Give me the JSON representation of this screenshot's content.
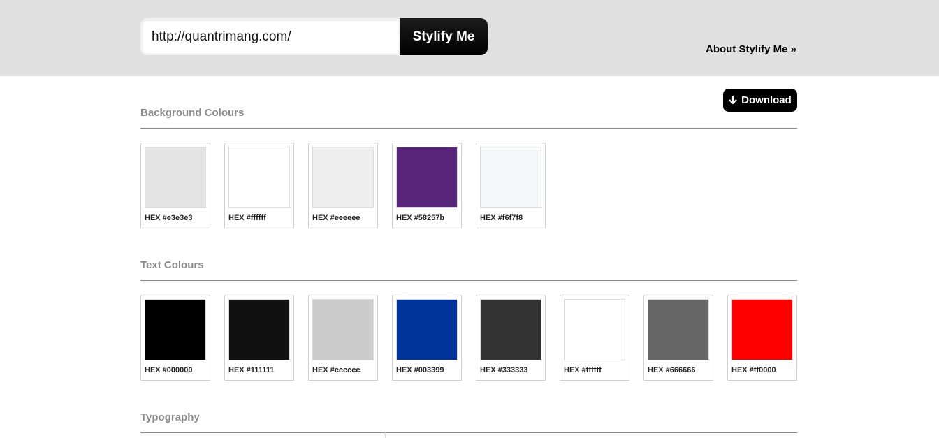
{
  "header": {
    "url_value": "http://quantrimang.com/",
    "submit_label": "Stylify Me",
    "about_label": "About Stylify Me »"
  },
  "download": {
    "label": "Download"
  },
  "background_colours": {
    "title": "Background Colours",
    "swatches": [
      {
        "color": "#e3e3e3",
        "label": "HEX #e3e3e3"
      },
      {
        "color": "#ffffff",
        "label": "HEX #ffffff"
      },
      {
        "color": "#eeeeee",
        "label": "HEX #eeeeee"
      },
      {
        "color": "#58257b",
        "label": "HEX #58257b"
      },
      {
        "color": "#f6f7f8",
        "label": "HEX #f6f7f8"
      }
    ]
  },
  "text_colours": {
    "title": "Text Colours",
    "swatches": [
      {
        "color": "#000000",
        "label": "HEX #000000"
      },
      {
        "color": "#111111",
        "label": "HEX #111111"
      },
      {
        "color": "#cccccc",
        "label": "HEX #cccccc"
      },
      {
        "color": "#003399",
        "label": "HEX #003399"
      },
      {
        "color": "#333333",
        "label": "HEX #333333"
      },
      {
        "color": "#ffffff",
        "label": "HEX #ffffff"
      },
      {
        "color": "#666666",
        "label": "HEX #666666"
      },
      {
        "color": "#ff0000",
        "label": "HEX #ff0000"
      }
    ]
  },
  "typography": {
    "title": "Typography"
  }
}
